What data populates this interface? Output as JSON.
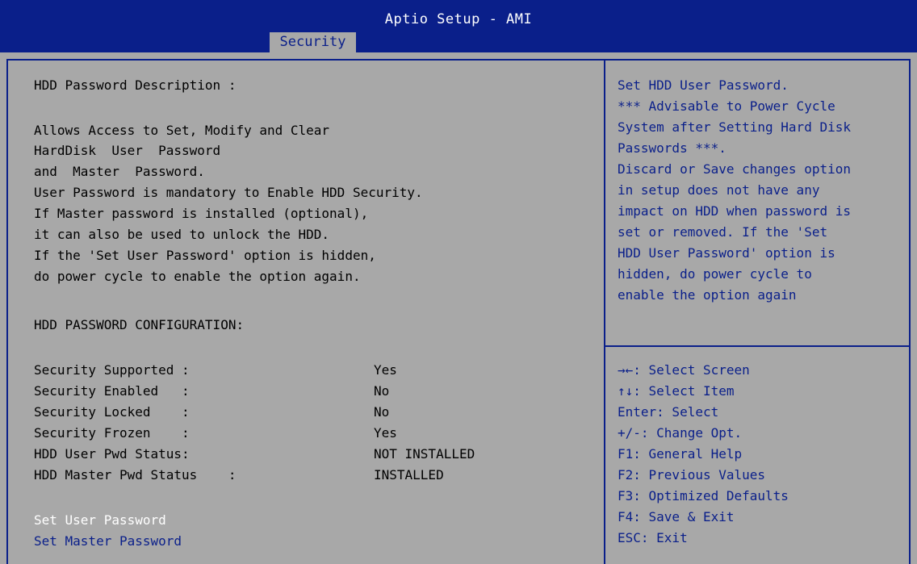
{
  "app_title": "Aptio Setup - AMI",
  "active_tab": "Security",
  "description": {
    "heading": "HDD Password Description :",
    "lines": [
      "Allows Access to Set, Modify and Clear",
      "HardDisk  User  Password",
      "and  Master  Password.",
      "User Password is mandatory to Enable HDD Security.",
      "If Master password is installed (optional),",
      "it can also be used to unlock the HDD.",
      "If the 'Set User Password' option is hidden,",
      "do power cycle to enable the option again."
    ]
  },
  "config": {
    "heading": "HDD PASSWORD CONFIGURATION:",
    "rows": [
      {
        "label": "Security Supported :",
        "value": "Yes"
      },
      {
        "label": "Security Enabled   :",
        "value": "No"
      },
      {
        "label": "Security Locked    :",
        "value": "No"
      },
      {
        "label": "Security Frozen    :",
        "value": "Yes"
      },
      {
        "label": "HDD User Pwd Status:",
        "value": "NOT INSTALLED"
      },
      {
        "label": "HDD Master Pwd Status    :",
        "value": "INSTALLED"
      }
    ]
  },
  "options": {
    "set_user_password": "Set User Password",
    "set_master_password": "Set Master Password"
  },
  "help": {
    "lines": [
      "Set HDD User Password.",
      "*** Advisable to Power Cycle",
      "System after Setting Hard Disk",
      "Passwords ***.",
      "Discard or Save changes option",
      "in setup does not have any",
      "impact on HDD when password is",
      "set or removed. If the 'Set",
      "HDD User Password' option is",
      "hidden, do power cycle to",
      "enable the option again"
    ]
  },
  "keys": [
    "→←: Select Screen",
    "↑↓: Select Item",
    "Enter: Select",
    "+/-: Change Opt.",
    "F1: General Help",
    "F2: Previous Values",
    "F3: Optimized Defaults",
    "F4: Save & Exit",
    "ESC: Exit"
  ],
  "colors": {
    "bios_blue": "#0a1f8a",
    "bios_gray": "#a8a8a8",
    "selected_text": "#ffffff"
  }
}
